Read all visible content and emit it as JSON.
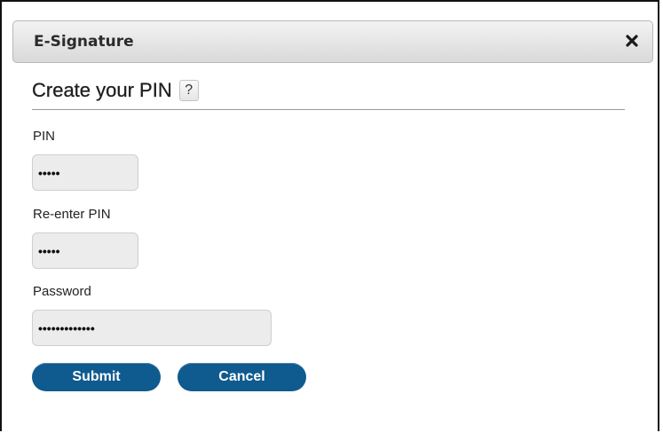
{
  "dialog": {
    "title": "E-Signature",
    "close_icon": "close-x-icon"
  },
  "form": {
    "heading": "Create your PIN",
    "help_label": "?",
    "fields": {
      "pin": {
        "label": "PIN",
        "value": "•••••"
      },
      "reenter_pin": {
        "label": "Re-enter PIN",
        "value": "•••••"
      },
      "password": {
        "label": "Password",
        "value": "•••••••••••••"
      }
    },
    "buttons": {
      "submit": "Submit",
      "cancel": "Cancel"
    }
  },
  "colors": {
    "button_bg": "#0f5a8e",
    "field_bg": "#ececec",
    "titlebar_bg": "#e3e3e3"
  }
}
